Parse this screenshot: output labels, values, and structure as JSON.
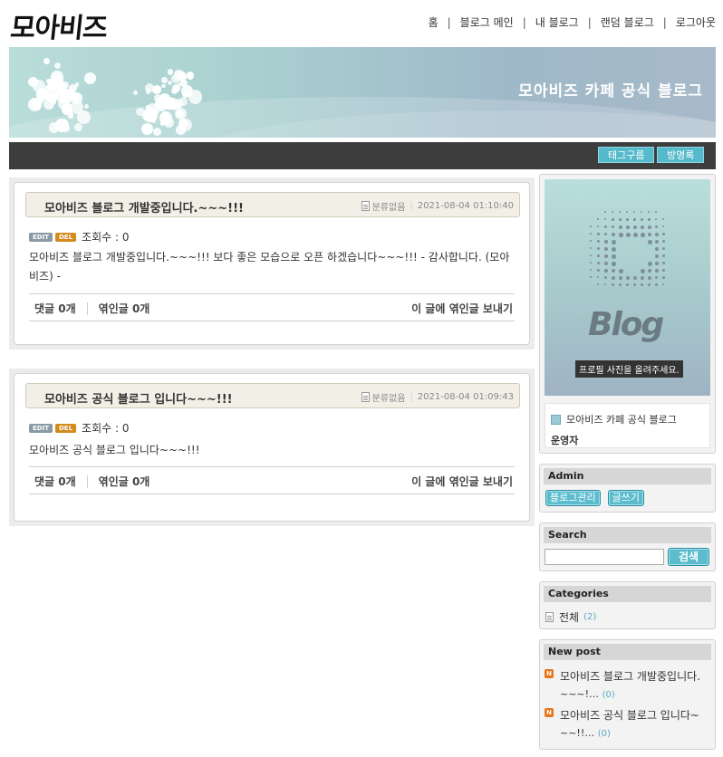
{
  "header": {
    "logo": "모아비즈",
    "nav": [
      "홈",
      "블로그 메인",
      "내 블로그",
      "랜덤 블로그",
      "로그아웃"
    ]
  },
  "banner": {
    "title": "모아비즈 카페 공식 블로그"
  },
  "toolbar": {
    "tag_cloud": "태그구름",
    "guestbook": "방명록"
  },
  "posts": [
    {
      "title": "모아비즈 블로그 개발중입니다.~~~!!!",
      "category": "분류없음",
      "datetime": "2021-08-04 01:10:40",
      "edit": "EDIT",
      "del": "DEL",
      "views": "조회수 : 0",
      "body": "모아비즈 블로그 개발중입니다.~~~!!! 보다 좋은 모습으로 오픈 하겠습니다~~~!!! - 감사합니다. (모아비즈) -",
      "comments": "댓글 0개",
      "trackbacks": "엮인글 0개",
      "send_trackback": "이 글에 엮인글 보내기"
    },
    {
      "title": "모아비즈 공식 블로그 입니다~~~!!!",
      "category": "분류없음",
      "datetime": "2021-08-04 01:09:43",
      "edit": "EDIT",
      "del": "DEL",
      "views": "조회수 : 0",
      "body": "모아비즈 공식 블로그 입니다~~~!!!",
      "comments": "댓글 0개",
      "trackbacks": "엮인글 0개",
      "send_trackback": "이 글에 엮인글 보내기"
    }
  ],
  "profile": {
    "image_word": "Blog",
    "image_caption": "프로필 사진을 올려주세요.",
    "blog_name": "모아비즈 카페 공식 블로그",
    "role": "운영자"
  },
  "admin": {
    "title": "Admin",
    "manage": "블로그관리",
    "write": "글쓰기"
  },
  "search": {
    "title": "Search",
    "value": "",
    "button": "검색"
  },
  "categories": {
    "title": "Categories",
    "items": [
      {
        "label": "전체",
        "count": "(2)"
      }
    ]
  },
  "newpost": {
    "title": "New post",
    "items": [
      {
        "line1": "모아비즈 블로그 개발중입니다.",
        "line2": "~~~!…",
        "count": "(0)"
      },
      {
        "line1": "모아비즈 공식 블로그 입니다~",
        "line2": "~~!!…",
        "count": "(0)"
      }
    ]
  },
  "colors": {
    "accent": "#55bacb",
    "dark_bar": "#3d3d3d",
    "post_head_bg": "#f2f0e6"
  }
}
